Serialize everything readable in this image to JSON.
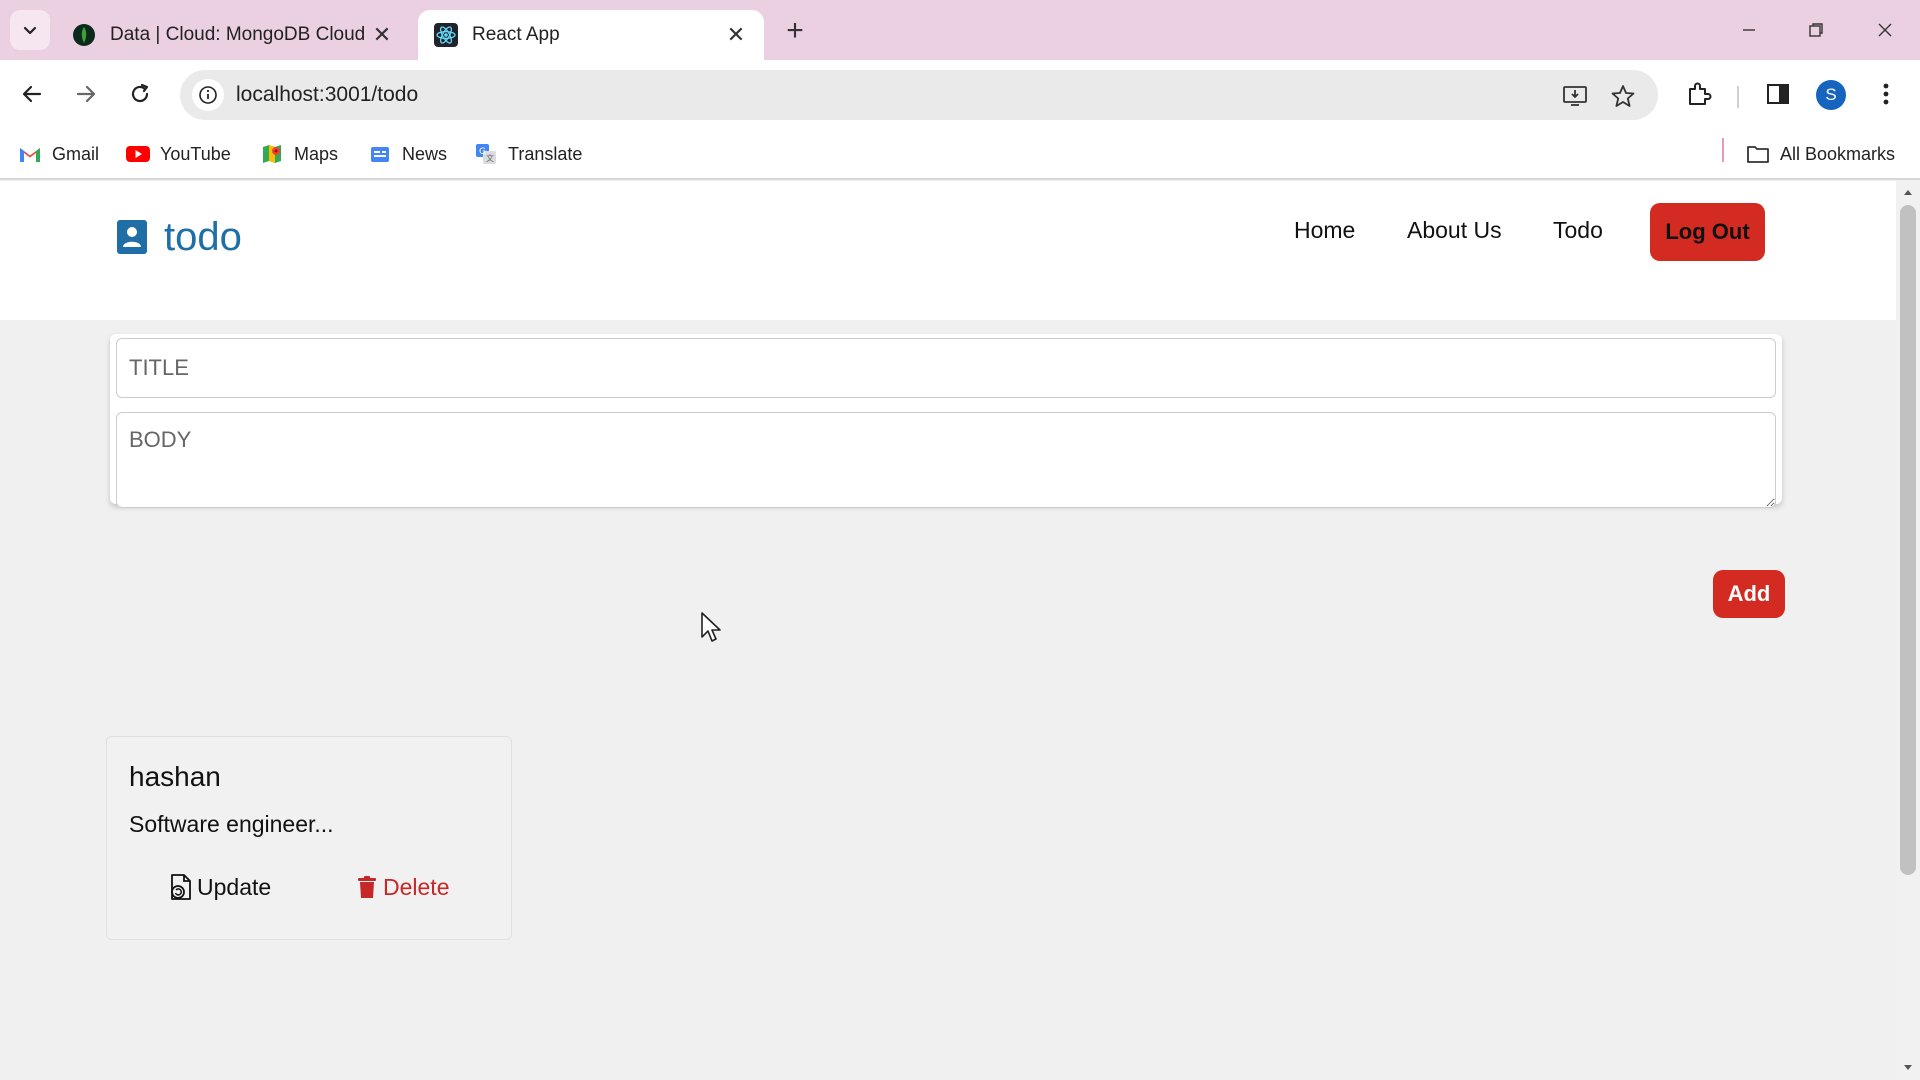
{
  "browser": {
    "tabs": [
      {
        "title": "Data | Cloud: MongoDB Cloud",
        "favicon": "mongodb-leaf-icon",
        "active": false
      },
      {
        "title": "React App",
        "favicon": "react-icon",
        "active": true
      }
    ],
    "url": "localhost:3001/todo",
    "profile_initial": "S",
    "bookmarks": [
      {
        "label": "Gmail",
        "icon": "gmail-icon"
      },
      {
        "label": "YouTube",
        "icon": "youtube-icon"
      },
      {
        "label": "Maps",
        "icon": "maps-icon"
      },
      {
        "label": "News",
        "icon": "news-icon"
      },
      {
        "label": "Translate",
        "icon": "translate-icon"
      }
    ],
    "all_bookmarks_label": "All Bookmarks"
  },
  "app": {
    "brand": "todo",
    "nav": [
      {
        "label": "Home"
      },
      {
        "label": "About Us"
      },
      {
        "label": "Todo"
      }
    ],
    "logout_label": "Log Out",
    "form": {
      "title_placeholder": "TITLE",
      "body_placeholder": "BODY",
      "add_label": "Add"
    },
    "todos": [
      {
        "title": "hashan",
        "body": "Software engineer...",
        "update_label": "Update",
        "delete_label": "Delete"
      }
    ]
  },
  "colors": {
    "tabstrip": "#ead0e1",
    "brand_blue": "#1f6fa6",
    "danger_red": "#d32b21",
    "delete_red": "#c62828",
    "page_bg": "#f0f0f0"
  }
}
